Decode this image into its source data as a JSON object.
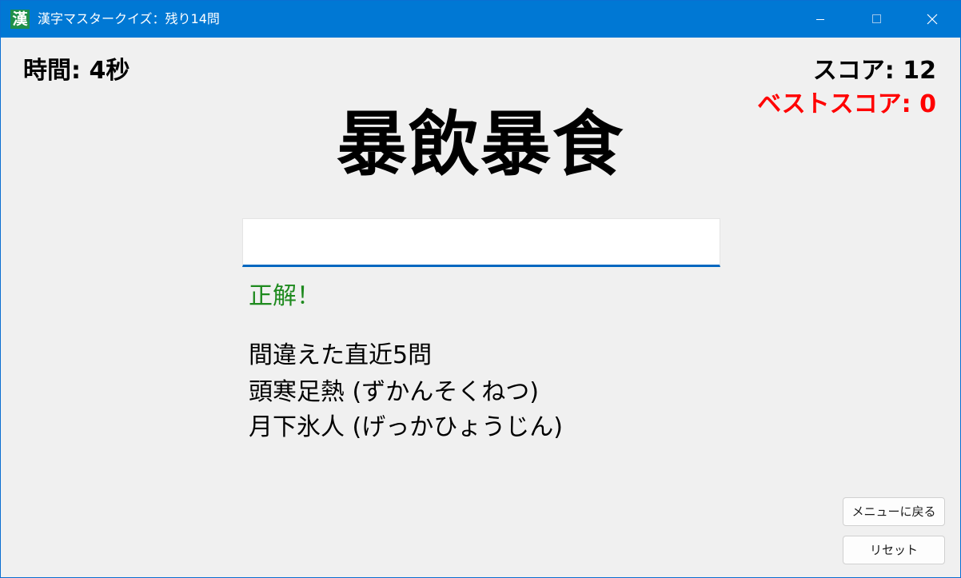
{
  "window": {
    "icon_glyph": "漢",
    "title": "漢字マスタークイズ：残り14問",
    "controls": [
      "minimize-icon",
      "maximize-icon",
      "close-icon"
    ]
  },
  "status": {
    "timer": "時間: 4秒",
    "score": "スコア: 12",
    "best_score": "ベストスコア: 0"
  },
  "quiz": {
    "question": "暴飲暴食",
    "answer_value": "",
    "feedback": "正解！"
  },
  "missed": {
    "title": "間違えた直近5問",
    "items": [
      "頭寒足熱 (ずかんそくねつ)",
      "月下氷人 (げっかひょうじん)"
    ]
  },
  "buttons": {
    "menu": "メニューに戻る",
    "reset": "リセット"
  },
  "colors": {
    "titlebar": "#0078d4",
    "best_score": "#ff0000",
    "feedback": "#1e8a1e",
    "input_underline": "#0067c0"
  }
}
